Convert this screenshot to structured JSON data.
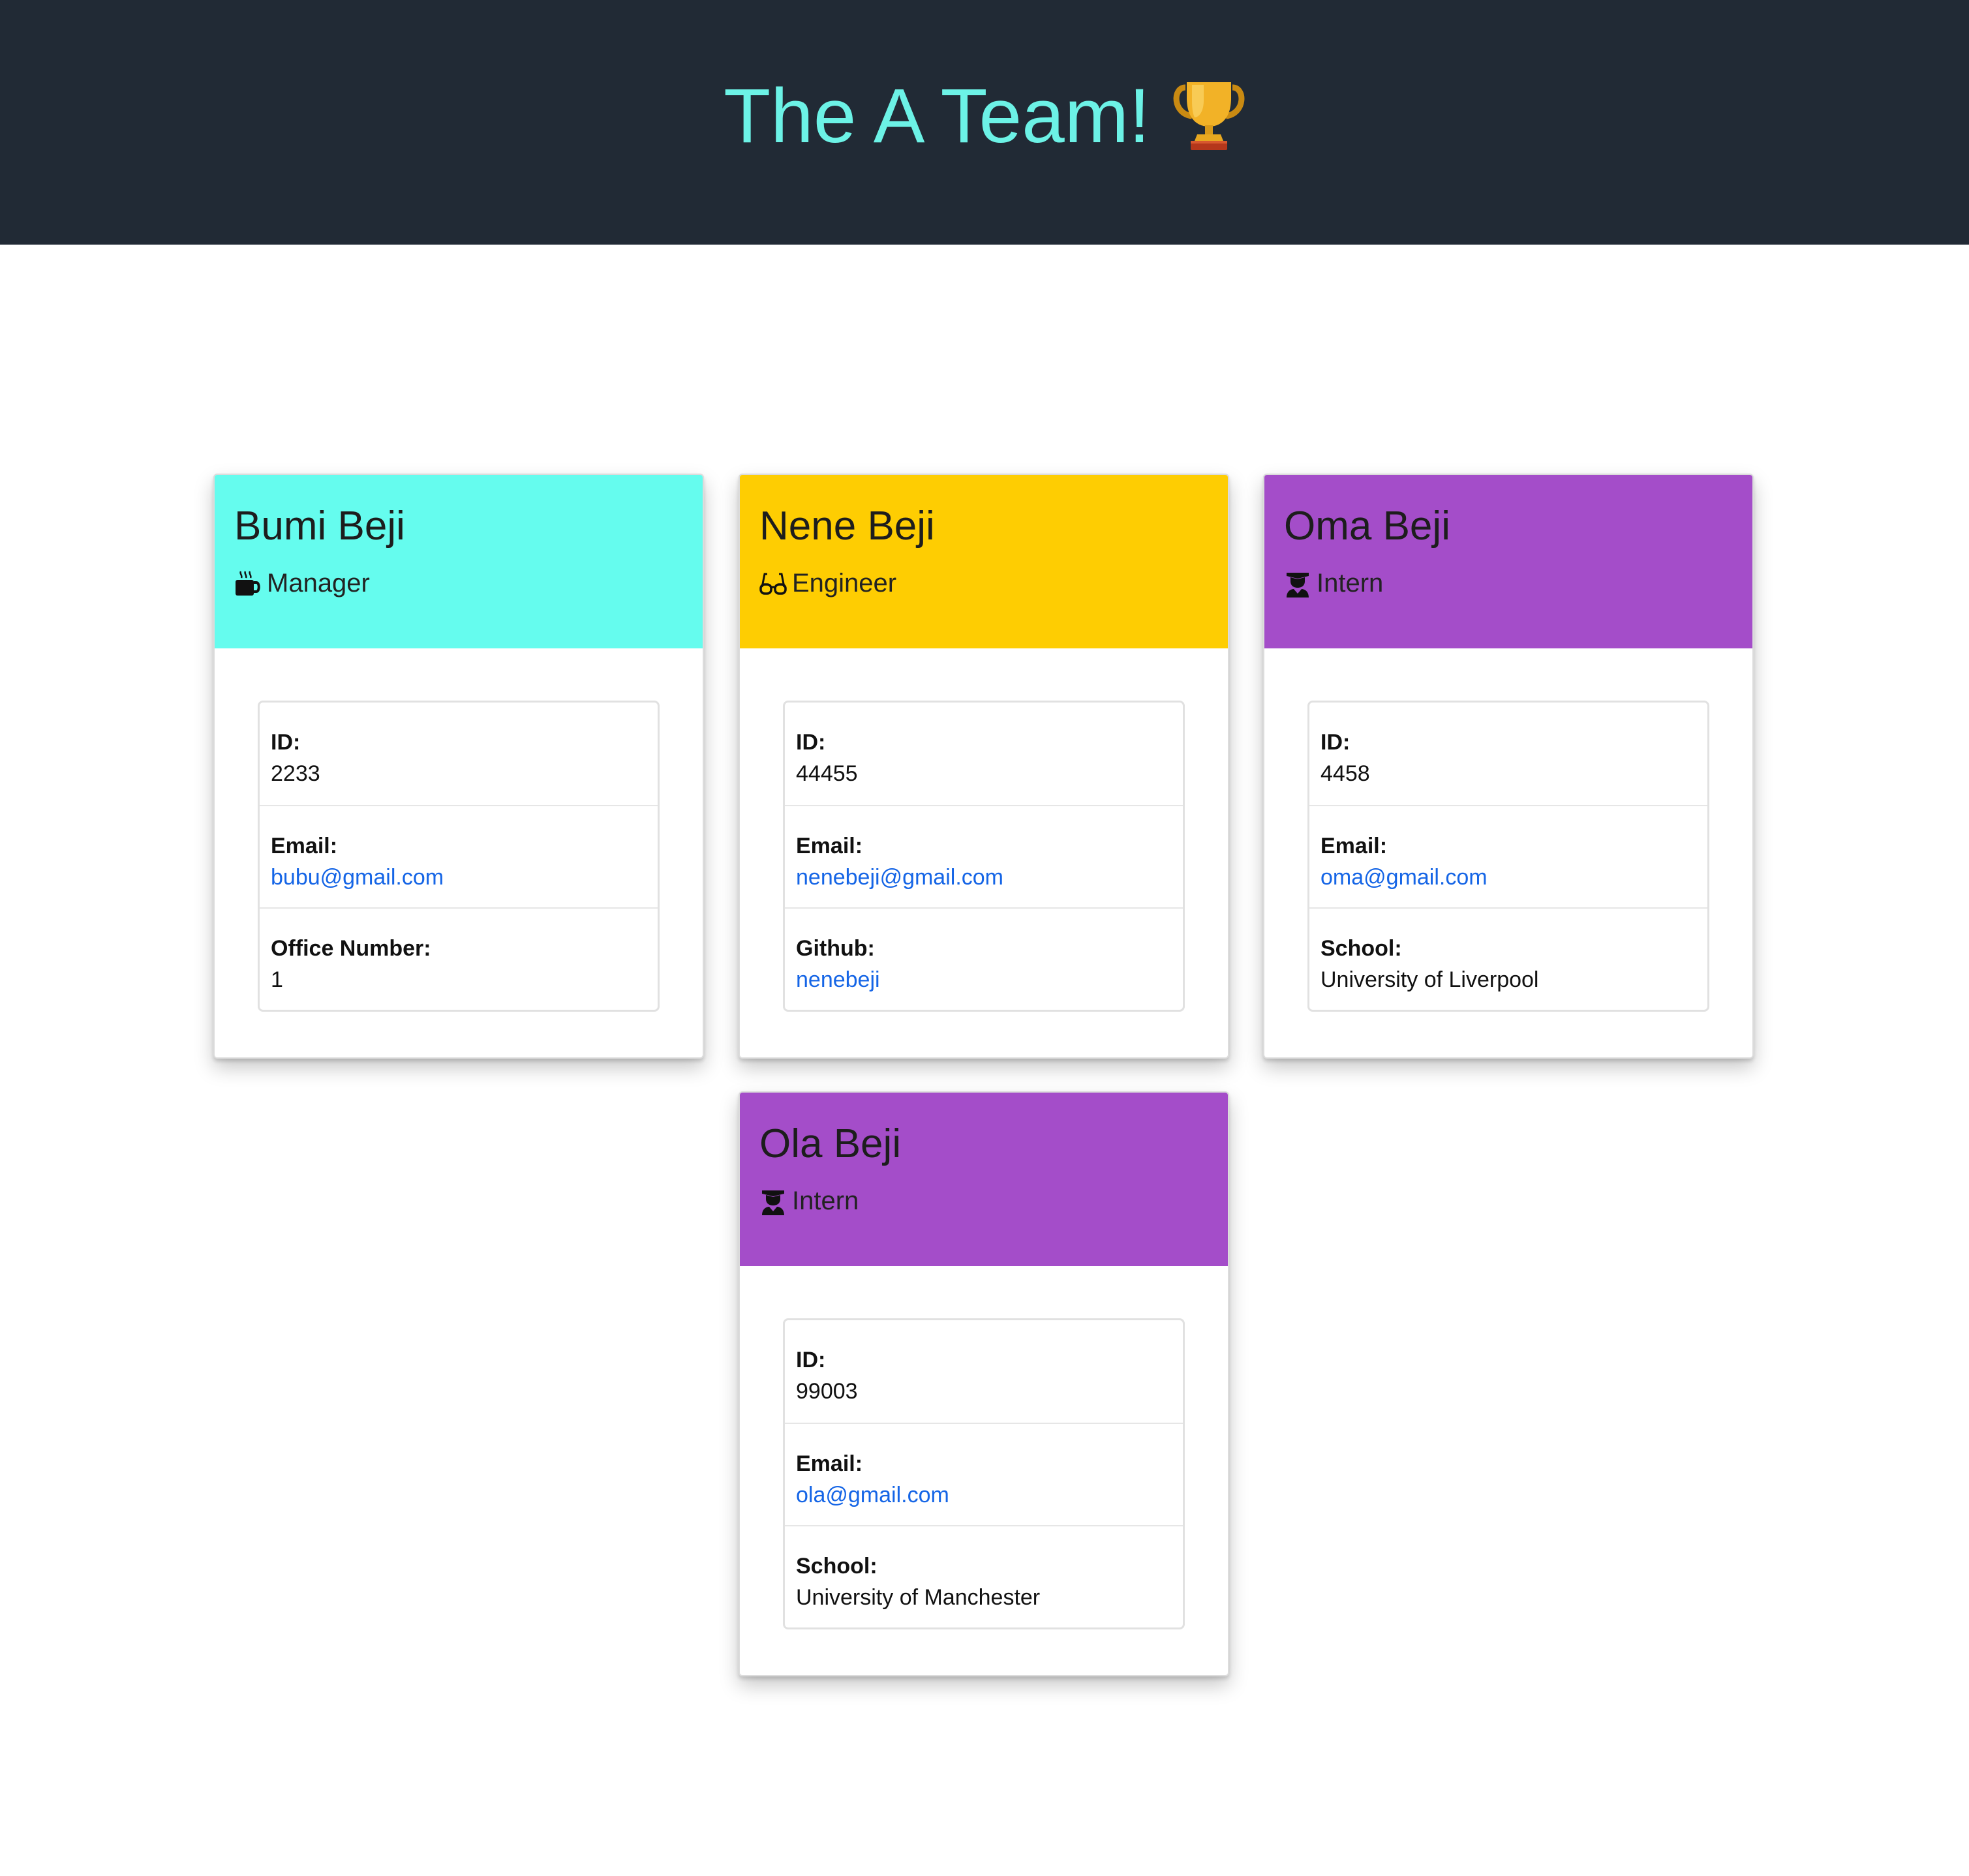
{
  "header": {
    "title": "The A Team!",
    "icon": "trophy-icon"
  },
  "colors": {
    "header_bg": "#212a35",
    "title": "#6cf2e6",
    "manager": "#65fcee",
    "engineer": "#fecd02",
    "intern": "#a44dc9",
    "link": "#1565e6"
  },
  "cards": [
    {
      "name": "Bumi Beji",
      "role": "Manager",
      "role_icon": "mug-icon",
      "id_label": "ID:",
      "id": "2233",
      "email_label": "Email:",
      "email": "bubu@gmail.com",
      "extra_label": "Office Number:",
      "extra_value": "1"
    },
    {
      "name": "Nene Beji",
      "role": "Engineer",
      "role_icon": "glasses-icon",
      "id_label": "ID:",
      "id": "44455",
      "email_label": "Email:",
      "email": "nenebeji@gmail.com",
      "extra_label": "Github:",
      "extra_value": "nenebeji"
    },
    {
      "name": "Oma Beji",
      "role": "Intern",
      "role_icon": "graduate-icon",
      "id_label": "ID:",
      "id": "4458",
      "email_label": "Email:",
      "email": "oma@gmail.com",
      "extra_label": "School:",
      "extra_value": "University of Liverpool"
    },
    {
      "name": "Ola Beji",
      "role": "Intern",
      "role_icon": "graduate-icon",
      "id_label": "ID:",
      "id": "99003",
      "email_label": "Email:",
      "email": "ola@gmail.com",
      "extra_label": "School:",
      "extra_value": "University of Manchester"
    }
  ]
}
